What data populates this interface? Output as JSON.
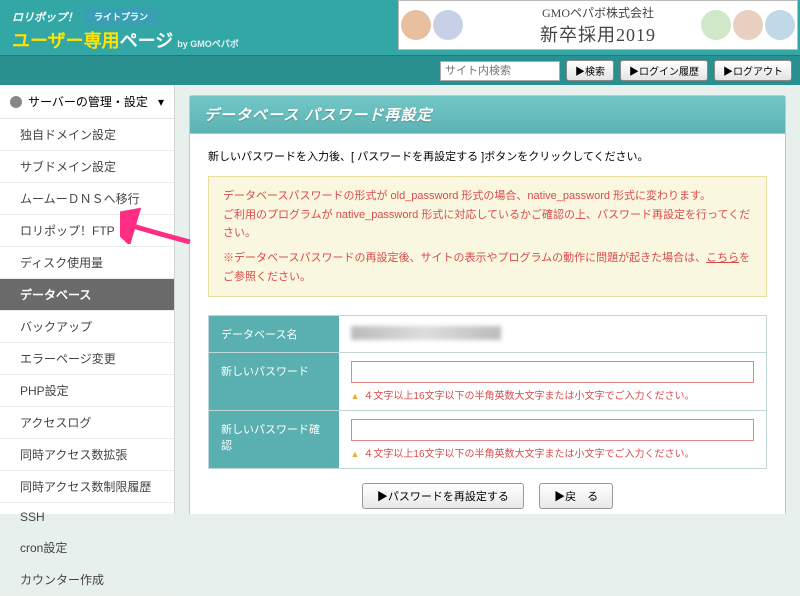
{
  "header": {
    "brand_top": "ロリポップ！",
    "plan": "ライトプラン",
    "brand_main_a": "ユーザー",
    "brand_main_b": "専用",
    "brand_main_c": "ページ",
    "by": "by GMOペパボ"
  },
  "banner": {
    "company": "GMOペパボ株式会社",
    "line2": "新卒採用2019"
  },
  "toolbar": {
    "search_placeholder": "サイト内検索",
    "search_btn": "検索",
    "login_history_btn": "ログイン履歴",
    "logout_btn": "ログアウト"
  },
  "sidebar": {
    "head": "サーバーの管理・設定",
    "items": [
      "独自ドメイン設定",
      "サブドメイン設定",
      "ムームーＤＮＳへ移行",
      "ロリポップ！FTP",
      "ディスク使用量",
      "データベース",
      "バックアップ",
      "エラーページ変更",
      "PHP設定",
      "アクセスログ",
      "同時アクセス数拡張",
      "同時アクセス数制限履歴",
      "SSH",
      "cron設定",
      "カウンター作成"
    ],
    "active_index": 5
  },
  "panel": {
    "title": "データベース パスワード再設定",
    "instruction": "新しいパスワードを入力後、[ パスワードを再設定する ]ボタンをクリックしてください。",
    "warn_line1": "データベースパスワードの形式が old_password 形式の場合、native_password 形式に変わります。",
    "warn_line2": "ご利用のプログラムが native_password 形式に対応しているかご確認の上、パスワード再設定を行ってください。",
    "warn_line3_a": "※データベースパスワードの再設定後、サイトの表示やプログラムの動作に問題が起きた場合は、",
    "warn_link": "こちら",
    "warn_line3_b": "をご参照ください。",
    "row1_label": "データベース名",
    "row2_label": "新しいパスワード",
    "row3_label": "新しいパスワード確認",
    "note": "４文字以上16文字以下の半角英数大文字または小文字でご入力ください。",
    "submit": "パスワードを再設定する",
    "back": "戻　る"
  }
}
